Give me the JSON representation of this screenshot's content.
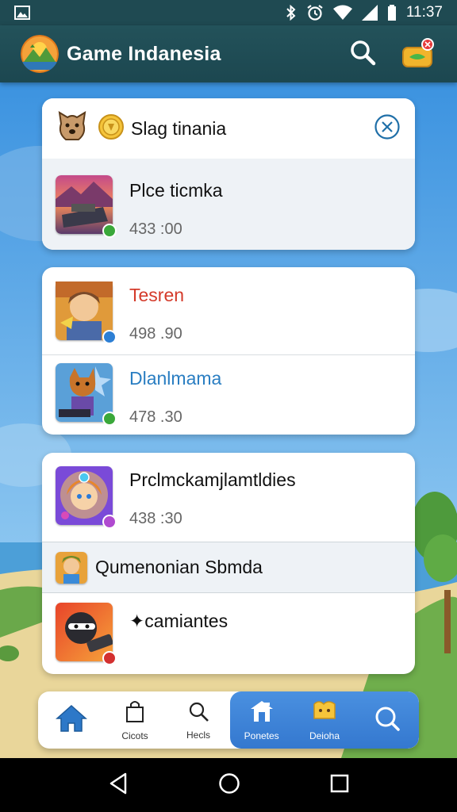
{
  "status_bar": {
    "time": "11:37",
    "image_icon": "image-icon",
    "icons": [
      "bluetooth-icon",
      "alarm-icon",
      "wifi-icon",
      "signal-icon",
      "battery-icon"
    ]
  },
  "app_bar": {
    "title": "Game Indanesia",
    "logo_icon": "landscape-logo-icon",
    "search_icon": "search-icon",
    "gift_icon": "gift-icon"
  },
  "cards": [
    {
      "header": {
        "title": "Slag tinania",
        "icons": [
          "dog-icon",
          "coin-icon"
        ],
        "close_icon": "close-icon"
      },
      "rows": [
        {
          "title": "Plce ticmka",
          "value": "433 :00",
          "badge_color": "#3aa83a"
        }
      ]
    },
    {
      "rows": [
        {
          "title": "Tesren",
          "value": "498 .90",
          "title_color": "#d43a2a",
          "badge_color": "#2d7fd4"
        },
        {
          "title": "Dlanlmama",
          "value": "478 .30",
          "title_color": "#2a7ec2",
          "badge_color": "#3aa83a"
        }
      ]
    },
    {
      "rows": [
        {
          "title": "Prclmckamjlamtldies",
          "value": "438 :30",
          "badge_color": "#b04ad0"
        }
      ],
      "small_row": {
        "title": "Qumenonian Sbmda"
      },
      "last_row": {
        "title": "✦camiantes",
        "badge_color": "#d33030"
      }
    }
  ],
  "bottom_nav": {
    "items": [
      {
        "label": "",
        "icon": "home-icon"
      },
      {
        "label": "Cicots",
        "icon": "bag-icon"
      },
      {
        "label": "Hecls",
        "icon": "search-icon"
      },
      {
        "label": "Ponetes",
        "icon": "store-icon"
      },
      {
        "label": "Deioha",
        "icon": "puzzle-icon"
      },
      {
        "label": "",
        "icon": "search-icon"
      }
    ],
    "accent": "#3a80d6"
  },
  "system_nav": {
    "icons": [
      "back-icon",
      "home-circle-icon",
      "recents-icon"
    ]
  },
  "colors": {
    "app_bar": "#1f4a52",
    "sky": "#4aa0e4",
    "ground": "#e9d69a"
  }
}
